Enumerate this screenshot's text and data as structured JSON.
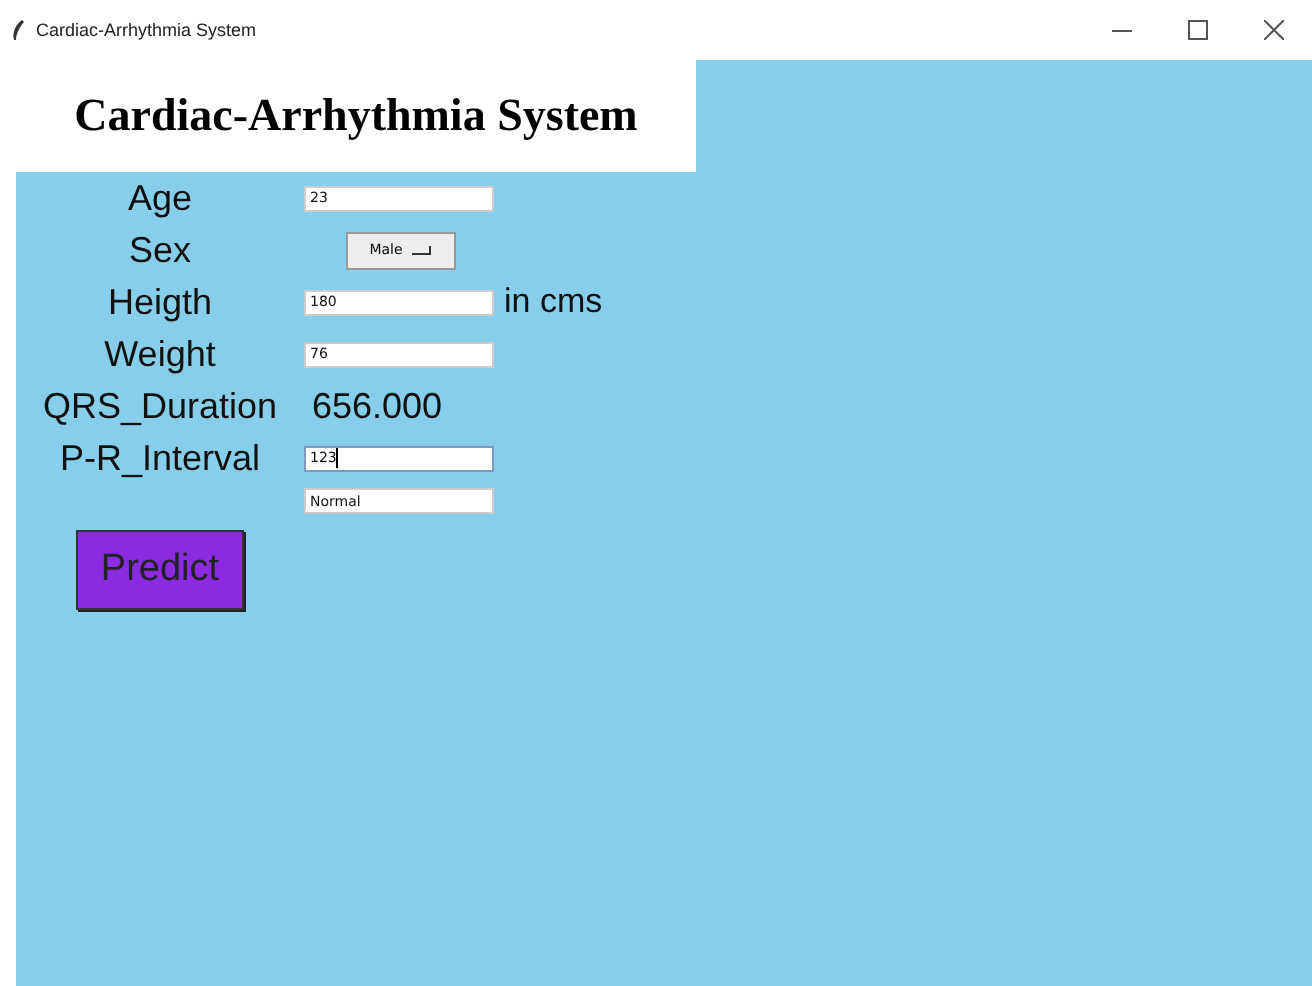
{
  "window": {
    "title": "Cardiac-Arrhythmia System"
  },
  "heading": "Cardiac-Arrhythmia System",
  "fields": [
    {
      "kind": "entry",
      "label": "Age",
      "value": "23",
      "focused": false
    },
    {
      "kind": "dropdown",
      "label": "Sex",
      "value": "Male"
    },
    {
      "kind": "entry",
      "label": "Heigth",
      "value": "180",
      "suffix": "in cms",
      "focused": false
    },
    {
      "kind": "entry",
      "label": "Weight",
      "value": "76",
      "focused": false
    },
    {
      "kind": "readout",
      "label": "QRS_Duration",
      "value": "656.000"
    },
    {
      "kind": "entry",
      "label": "P-R_Interval",
      "value": "123",
      "focused": true
    },
    {
      "kind": "entry",
      "value": "Normal",
      "focused": false
    }
  ],
  "buttons": [
    {
      "label": "Predict"
    }
  ]
}
